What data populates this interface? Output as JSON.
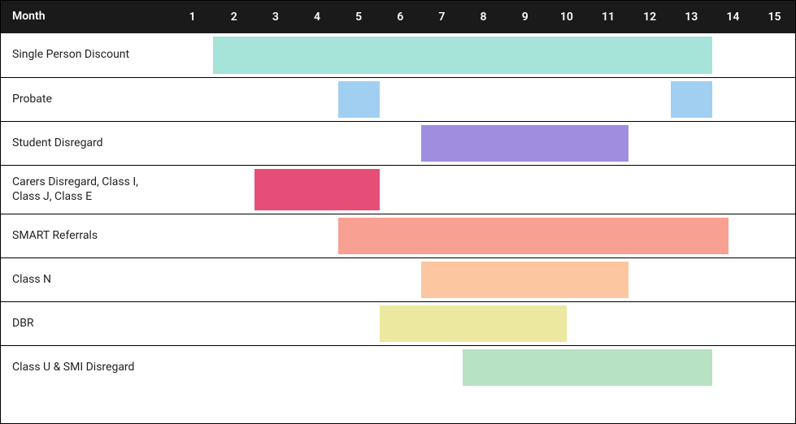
{
  "chart_data": {
    "type": "gantt",
    "xlabel": "Month",
    "months": [
      1,
      2,
      3,
      4,
      5,
      6,
      7,
      8,
      9,
      10,
      11,
      12,
      13,
      14,
      15
    ],
    "x_range": [
      0.5,
      15.5
    ],
    "tasks": [
      {
        "label": "Single Person Discount",
        "spans": [
          {
            "start": 2,
            "end": 14
          }
        ],
        "color": "#a6e3d8"
      },
      {
        "label": "Probate",
        "spans": [
          {
            "start": 5,
            "end": 6
          },
          {
            "start": 13,
            "end": 14
          }
        ],
        "color": "#a1cff2"
      },
      {
        "label": "Student Disregard",
        "spans": [
          {
            "start": 7,
            "end": 12
          }
        ],
        "color": "#a08de0"
      },
      {
        "label": "Carers Disregard, Class I, Class J, Class E",
        "spans": [
          {
            "start": 3,
            "end": 6
          }
        ],
        "color": "#e64e77"
      },
      {
        "label": "SMART Referrals",
        "spans": [
          {
            "start": 5,
            "end": 14.4
          }
        ],
        "color": "#f8a091"
      },
      {
        "label": "Class N",
        "spans": [
          {
            "start": 7,
            "end": 12
          }
        ],
        "color": "#fbc6a0"
      },
      {
        "label": "DBR",
        "spans": [
          {
            "start": 6,
            "end": 10.5
          }
        ],
        "color": "#ece8a0"
      },
      {
        "label": "Class U & SMI Disregard",
        "spans": [
          {
            "start": 8,
            "end": 14
          }
        ],
        "color": "#b7e2c4"
      }
    ]
  }
}
